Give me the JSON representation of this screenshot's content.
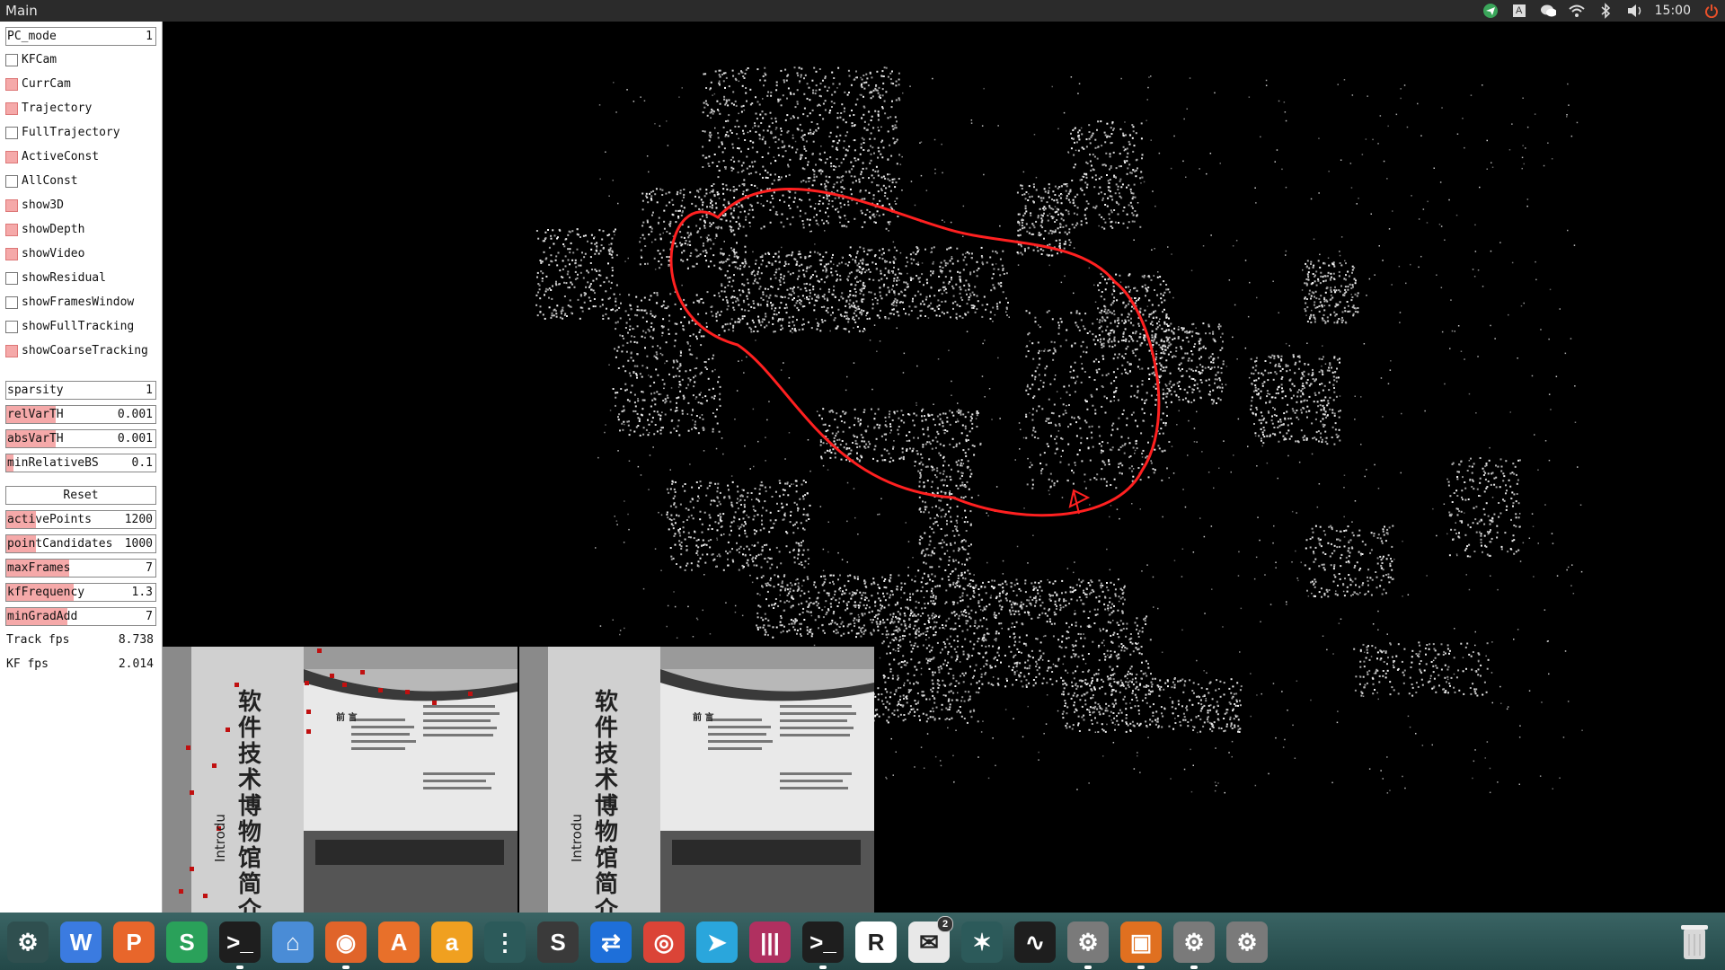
{
  "window_title": "Main",
  "tray": {
    "icons": [
      "telegram-tray-icon",
      "keyboard-a-icon",
      "wechat-tray-icon",
      "wifi-icon",
      "bluetooth-icon",
      "volume-icon",
      "power-icon"
    ],
    "keyboard_letter": "A",
    "clock": "15:00"
  },
  "panel": {
    "pc_mode": {
      "label": "PC_mode",
      "value": "1"
    },
    "checkboxes": [
      {
        "label": "KFCam",
        "checked": false
      },
      {
        "label": "CurrCam",
        "checked": true
      },
      {
        "label": "Trajectory",
        "checked": true
      },
      {
        "label": "FullTrajectory",
        "checked": false
      },
      {
        "label": "ActiveConst",
        "checked": true
      },
      {
        "label": "AllConst",
        "checked": false
      },
      {
        "label": "show3D",
        "checked": true
      },
      {
        "label": "showDepth",
        "checked": true
      },
      {
        "label": "showVideo",
        "checked": true
      },
      {
        "label": "showResidual",
        "checked": false
      },
      {
        "label": "showFramesWindow",
        "checked": false
      },
      {
        "label": "showFullTracking",
        "checked": false
      },
      {
        "label": "showCoarseTracking",
        "checked": true
      }
    ],
    "sparsity": {
      "label": "sparsity",
      "value": "1"
    },
    "sliders1": [
      {
        "label": "relVarTH",
        "value": "0.001",
        "level": 0.33
      },
      {
        "label": "absVarTH",
        "value": "0.001",
        "level": 0.33
      },
      {
        "label": "minRelativeBS",
        "value": "0.1",
        "level": 0.05
      }
    ],
    "reset_label": "Reset",
    "sliders2": [
      {
        "label": "activePoints",
        "value": "1200",
        "level": 0.2
      },
      {
        "label": "pointCandidates",
        "value": "1000",
        "level": 0.2
      },
      {
        "label": "maxFrames",
        "value": "7",
        "level": 0.42
      },
      {
        "label": "kfFrequency",
        "value": "1.3",
        "level": 0.45
      },
      {
        "label": "minGradAdd",
        "value": "7",
        "level": 0.41
      }
    ],
    "stats": [
      {
        "label": "Track fps",
        "value": "8.738"
      },
      {
        "label": "KF fps",
        "value": "2.014"
      }
    ]
  },
  "video": {
    "left_chars": [
      "软",
      "件",
      "技",
      "术",
      "博",
      "物",
      "馆",
      "简",
      "介"
    ],
    "right_chars": [
      "软",
      "件",
      "技",
      "术",
      "博",
      "物",
      "馆",
      "简",
      "介"
    ],
    "left_side_text": "Introdu",
    "right_side_text": "Introdu",
    "panel_heading": "前 言"
  },
  "dock": {
    "items": [
      {
        "name": "system-settings-icon",
        "glyph": "⚙",
        "color": "#2f4f4f",
        "running": false
      },
      {
        "name": "wps-writer-icon",
        "glyph": "W",
        "color": "#3b7be0",
        "running": false
      },
      {
        "name": "wps-presentation-icon",
        "glyph": "P",
        "color": "#e8662b",
        "running": false
      },
      {
        "name": "wps-spreadsheets-icon",
        "glyph": "S",
        "color": "#2aa15a",
        "running": false
      },
      {
        "name": "terminal-icon",
        "glyph": ">_",
        "color": "#1e1e1e",
        "running": true
      },
      {
        "name": "files-icon",
        "glyph": "⌂",
        "color": "#4a8cd6",
        "running": false
      },
      {
        "name": "firefox-icon",
        "glyph": "◉",
        "color": "#e0642a",
        "running": true
      },
      {
        "name": "software-center-icon",
        "glyph": "A",
        "color": "#e8702a",
        "running": false
      },
      {
        "name": "amazon-icon",
        "glyph": "a",
        "color": "#f0a020",
        "running": false
      },
      {
        "name": "equalizer-icon",
        "glyph": "⋮",
        "color": "#2c5a5a",
        "running": false
      },
      {
        "name": "sublime-text-icon",
        "glyph": "S",
        "color": "#3a3a3a",
        "running": false
      },
      {
        "name": "teamviewer-icon",
        "glyph": "⇄",
        "color": "#1e6fd9",
        "running": false
      },
      {
        "name": "chrome-icon",
        "glyph": "◎",
        "color": "#db4437",
        "running": false
      },
      {
        "name": "telegram-icon",
        "glyph": "➤",
        "color": "#2aa6dc",
        "running": false
      },
      {
        "name": "mixer-icon",
        "glyph": "|||",
        "color": "#b03060",
        "running": false
      },
      {
        "name": "terminal-2-icon",
        "glyph": ">_",
        "color": "#1e1e1e",
        "running": true
      },
      {
        "name": "rstudio-icon",
        "glyph": "R",
        "color": "#ffffff",
        "running": false
      },
      {
        "name": "wechat-icon",
        "glyph": "✉",
        "color": "#e8e8e8",
        "running": false
      },
      {
        "name": "inkscape-icon",
        "glyph": "✶",
        "color": "#2c5a5a",
        "running": false
      },
      {
        "name": "system-monitor-icon",
        "glyph": "∿",
        "color": "#1e1e1e",
        "running": false
      },
      {
        "name": "settings-gear-1-icon",
        "glyph": "⚙",
        "color": "#7a7a7a",
        "running": true
      },
      {
        "name": "virtualbox-icon",
        "glyph": "▣",
        "color": "#e07020",
        "running": true
      },
      {
        "name": "settings-gear-2-icon",
        "glyph": "⚙",
        "color": "#7a7a7a",
        "running": true
      },
      {
        "name": "settings-gear-3-icon",
        "glyph": "⚙",
        "color": "#7a7a7a",
        "running": false
      }
    ],
    "wechat_badge": "2",
    "trash_icon": "trash-icon"
  },
  "colors": {
    "accent": "#f5a9a9",
    "trajectory": "#ff2020",
    "panel_bg": "#ffffff",
    "dock": "#2d5656"
  }
}
